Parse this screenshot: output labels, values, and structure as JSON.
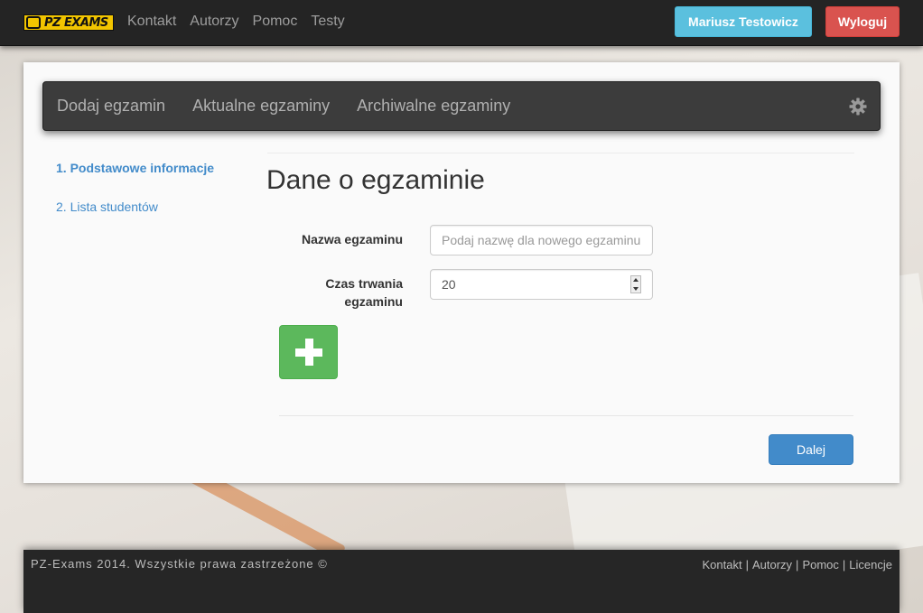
{
  "brand": {
    "logo_text": "PZ EXAMS"
  },
  "topnav": {
    "items": [
      "Kontakt",
      "Autorzy",
      "Pomoc",
      "Testy"
    ]
  },
  "user": {
    "name": "Mariusz Testowicz",
    "logout_label": "Wyloguj"
  },
  "subnav": {
    "items": [
      "Dodaj egzamin",
      "Aktualne egzaminy",
      "Archiwalne egzaminy"
    ]
  },
  "steps": [
    {
      "label": "1. Podstawowe informacje",
      "active": true
    },
    {
      "label": "2. Lista studentów",
      "active": false
    }
  ],
  "form": {
    "heading": "Dane o egzaminie",
    "name_label": "Nazwa egzaminu",
    "name_placeholder": "Podaj nazwę dla nowego egzaminu",
    "duration_label_line1": "Czas trwania",
    "duration_label_line2": "egzaminu",
    "duration_value": "20",
    "next_label": "Dalej"
  },
  "footer": {
    "copyright": "PZ-Exams 2014. Wszystkie prawa zastrzeżone ©",
    "links": [
      "Kontakt",
      "Autorzy",
      "Pomoc",
      "Licencje"
    ]
  },
  "colors": {
    "info": "#5bc0de",
    "danger": "#d9534f",
    "primary": "#428bca",
    "success": "#5cb85c",
    "navbar": "#242424",
    "logo": "#f2c500"
  }
}
